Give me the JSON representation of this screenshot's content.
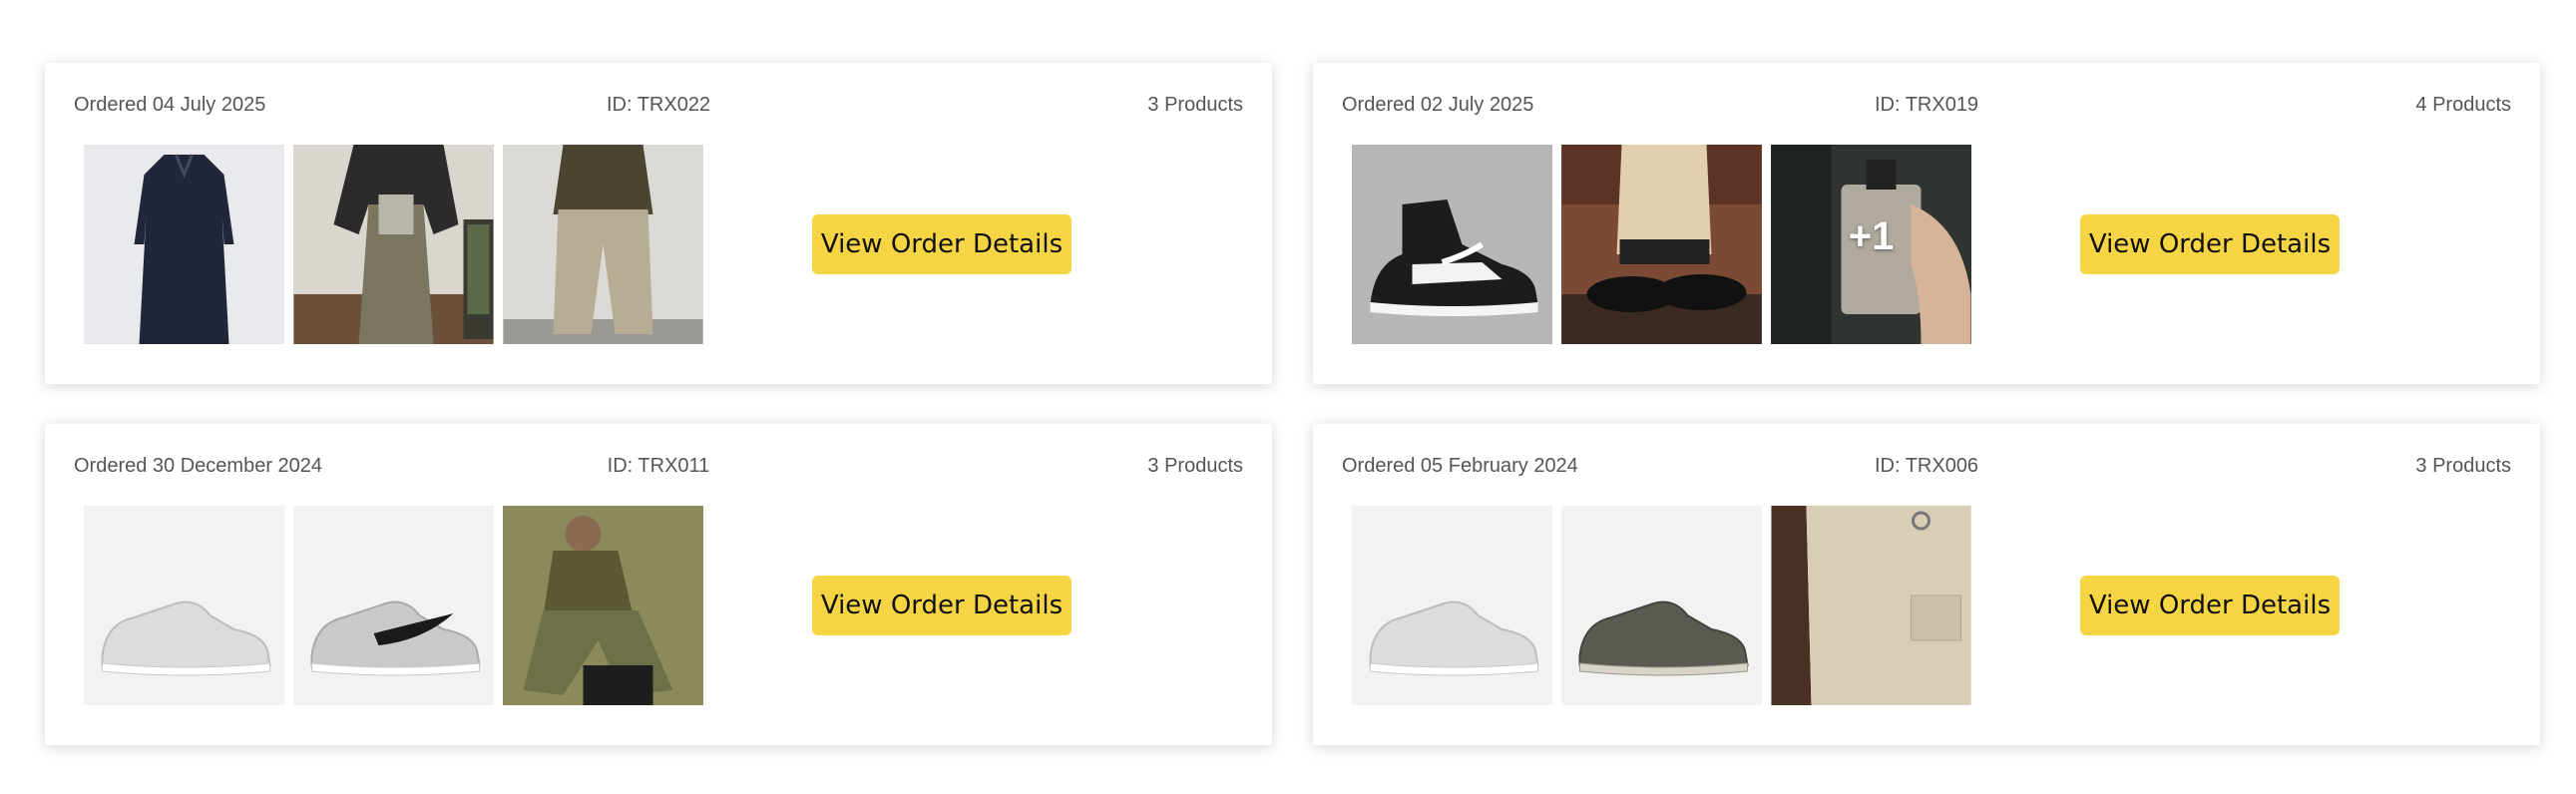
{
  "orders": [
    {
      "date_label": "Ordered 04 July 2025",
      "id_label": "ID: TRX022",
      "count_label": "3 Products",
      "button_label": "View Order Details",
      "thumbnails": [
        {
          "icon": "navy-shirt-dress-image"
        },
        {
          "icon": "layered-outfit-image"
        },
        {
          "icon": "khaki-trousers-image"
        }
      ]
    },
    {
      "date_label": "Ordered 02 July 2025",
      "id_label": "ID: TRX019",
      "count_label": "4 Products",
      "button_label": "View Order Details",
      "thumbnails": [
        {
          "icon": "black-white-sneaker-image"
        },
        {
          "icon": "black-loafers-image"
        },
        {
          "icon": "perfume-bottle-image",
          "overlay": "+1"
        }
      ]
    },
    {
      "date_label": "Ordered 30 December 2024",
      "id_label": "ID: TRX011",
      "count_label": "3 Products",
      "button_label": "View Order Details",
      "thumbnails": [
        {
          "icon": "white-sneaker-image"
        },
        {
          "icon": "grey-sneaker-image"
        },
        {
          "icon": "olive-outfit-image"
        }
      ]
    },
    {
      "date_label": "Ordered 05 February 2024",
      "id_label": "ID: TRX006",
      "count_label": "3 Products",
      "button_label": "View Order Details",
      "thumbnails": [
        {
          "icon": "white-sneaker-image"
        },
        {
          "icon": "dark-grey-sneaker-image"
        },
        {
          "icon": "cargo-shorts-image"
        }
      ]
    }
  ],
  "colors": {
    "button_bg": "#f6d545",
    "text_muted": "#555555",
    "card_bg": "#ffffff"
  }
}
